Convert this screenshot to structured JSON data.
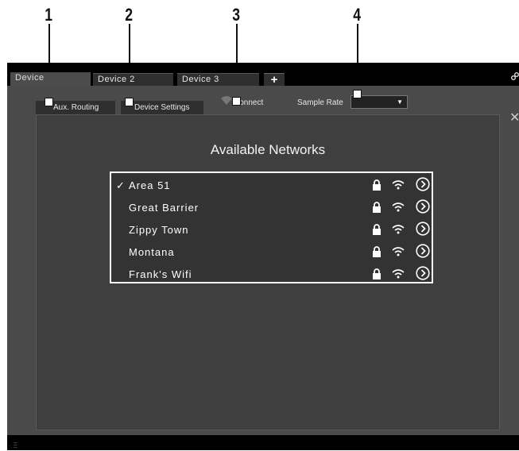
{
  "callouts": [
    "1",
    "2",
    "3",
    "4"
  ],
  "device_tabs": [
    {
      "label": "Device",
      "active": true
    },
    {
      "label": "Device 2",
      "active": false
    },
    {
      "label": "Device 3",
      "active": false
    }
  ],
  "add_tab_label": "+",
  "sub_tabs": [
    {
      "label": "Aux. Routing"
    },
    {
      "label": "Device Settings"
    }
  ],
  "connect_label": "Connect",
  "sample_rate_label": "Sample Rate",
  "sample_rate_value": "",
  "available_networks_title": "Available Networks",
  "networks": [
    {
      "name": "Area 51",
      "selected": true,
      "icons": [
        "lock-icon",
        "wifi-icon",
        "chevron-right-icon"
      ]
    },
    {
      "name": "Great Barrier",
      "selected": false,
      "icons": [
        "lock-icon",
        "wifi-icon",
        "chevron-right-icon"
      ]
    },
    {
      "name": "Zippy Town",
      "selected": false,
      "icons": [
        "lock-icon",
        "wifi-icon",
        "chevron-right-icon"
      ]
    },
    {
      "name": "Montana",
      "selected": false,
      "icons": [
        "lock-icon",
        "wifi-icon",
        "chevron-right-icon"
      ]
    },
    {
      "name": "Frank's Wifi",
      "selected": false,
      "icons": [
        "lock-icon",
        "wifi-icon",
        "chevron-right-icon"
      ]
    }
  ],
  "checkmark": "✓",
  "colors": {
    "accent": "#ffffff",
    "panel": "#4a4a4a",
    "content": "#3f3f3f",
    "list": "#333333"
  }
}
